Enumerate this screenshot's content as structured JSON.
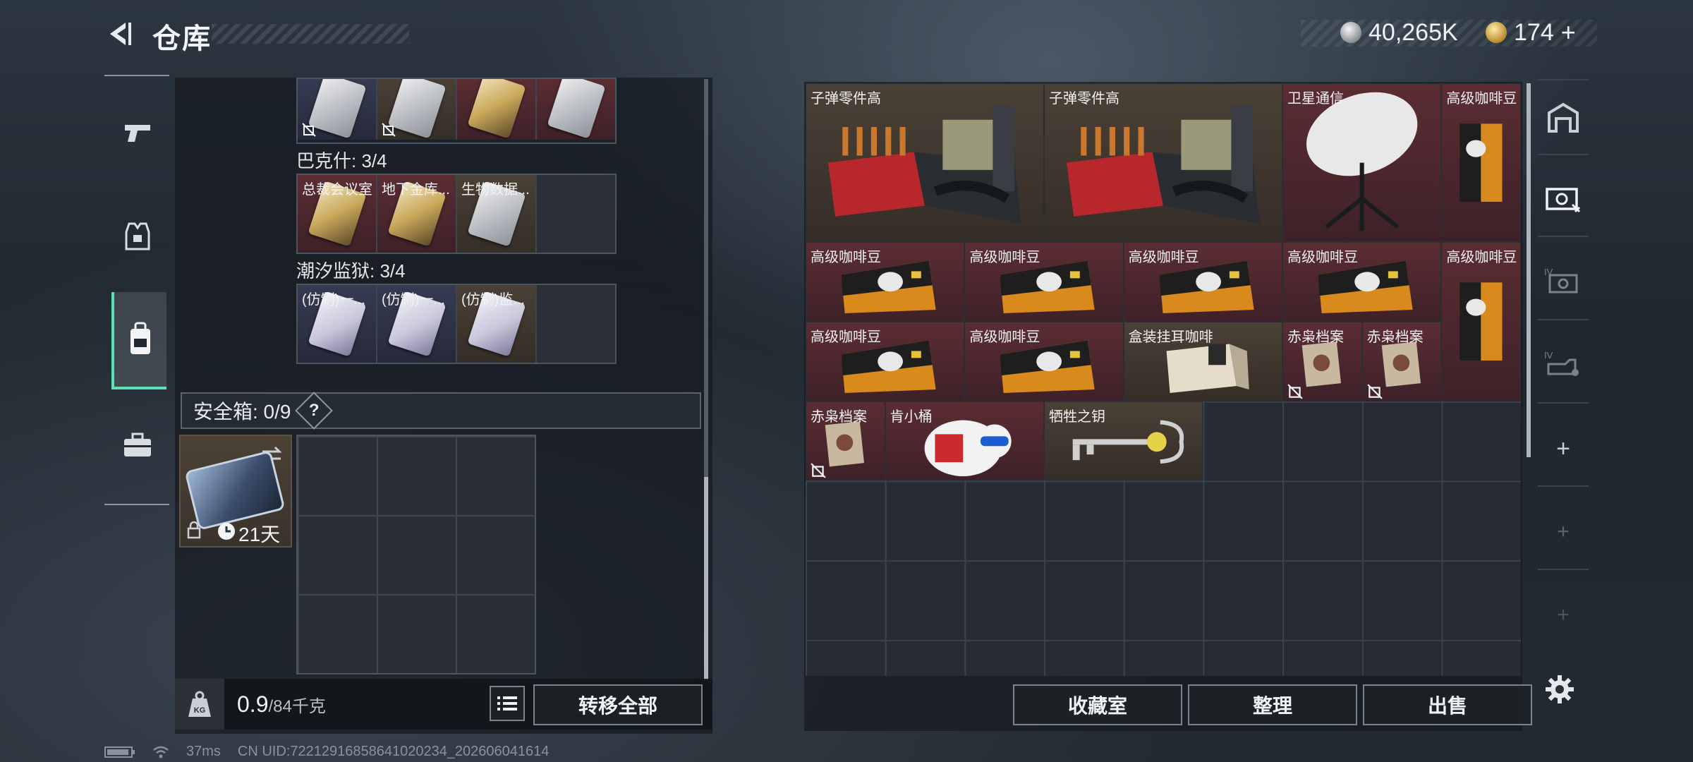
{
  "header": {
    "title": "仓库",
    "currency_silver": "40,265K",
    "currency_gold": "174"
  },
  "left_sidebar": {
    "tabs": [
      "weapons",
      "armor",
      "backpack",
      "briefcase"
    ],
    "active_index": 2
  },
  "keycards": {
    "sections": [
      {
        "name": null,
        "cells": [
          {
            "label": "",
            "tone": "blue",
            "card": "silver",
            "nodrop": true
          },
          {
            "label": "",
            "tone": "tan",
            "card": "silver",
            "nodrop": true
          },
          {
            "label": "",
            "tone": "red",
            "card": "gold",
            "nodrop": false
          },
          {
            "label": "",
            "tone": "red",
            "card": "silver",
            "nodrop": false
          }
        ]
      },
      {
        "name": "巴克什: 3/4",
        "cells": [
          {
            "label": "总裁会议室",
            "tone": "red",
            "card": "gold",
            "nodrop": false
          },
          {
            "label": "地下金库...",
            "tone": "red",
            "card": "gold",
            "nodrop": false
          },
          {
            "label": "生物数据...",
            "tone": "tan",
            "card": "silver",
            "nodrop": false
          },
          {
            "label": "",
            "tone": "empty",
            "card": null,
            "nodrop": false
          }
        ]
      },
      {
        "name": "潮汐监狱: 3/4",
        "cells": [
          {
            "label": "(仿制)一...",
            "tone": "blue",
            "card": "violet",
            "nodrop": false
          },
          {
            "label": "(仿制)一...",
            "tone": "blue",
            "card": "violet",
            "nodrop": false
          },
          {
            "label": "(仿制)监...",
            "tone": "tan",
            "card": "violet",
            "nodrop": false
          },
          {
            "label": "",
            "tone": "empty",
            "card": null,
            "nodrop": false
          }
        ]
      }
    ]
  },
  "safebox": {
    "label": "安全箱: 0/9",
    "help": "?",
    "duration": "21天"
  },
  "left_bottom": {
    "weight_current": "0.9",
    "weight_max": "/84千克",
    "transfer_all": "转移全部"
  },
  "stash_items": [
    {
      "label": "子弹零件高",
      "col": 0,
      "row": 0,
      "w": 3,
      "h": 2,
      "tone": "tan",
      "art": "ammo-crate"
    },
    {
      "label": "子弹零件高",
      "col": 3,
      "row": 0,
      "w": 3,
      "h": 2,
      "tone": "tan",
      "art": "ammo-crate"
    },
    {
      "label": "卫星通信",
      "col": 6,
      "row": 0,
      "w": 2,
      "h": 2,
      "tone": "red",
      "art": "satellite-dish"
    },
    {
      "label": "高级咖啡豆",
      "col": 8,
      "row": 0,
      "w": 1,
      "h": 2,
      "tone": "red",
      "art": "coffee-bag-tall"
    },
    {
      "label": "高级咖啡豆",
      "col": 0,
      "row": 2,
      "w": 2,
      "h": 1,
      "tone": "red",
      "art": "coffee-bag"
    },
    {
      "label": "高级咖啡豆",
      "col": 2,
      "row": 2,
      "w": 2,
      "h": 1,
      "tone": "red",
      "art": "coffee-bag"
    },
    {
      "label": "高级咖啡豆",
      "col": 4,
      "row": 2,
      "w": 2,
      "h": 1,
      "tone": "red",
      "art": "coffee-bag"
    },
    {
      "label": "高级咖啡豆",
      "col": 6,
      "row": 2,
      "w": 2,
      "h": 1,
      "tone": "red",
      "art": "coffee-bag"
    },
    {
      "label": "高级咖啡豆",
      "col": 8,
      "row": 2,
      "w": 1,
      "h": 2,
      "tone": "red",
      "art": "coffee-bag-tall"
    },
    {
      "label": "高级咖啡豆",
      "col": 0,
      "row": 3,
      "w": 2,
      "h": 1,
      "tone": "red",
      "art": "coffee-bag"
    },
    {
      "label": "高级咖啡豆",
      "col": 2,
      "row": 3,
      "w": 2,
      "h": 1,
      "tone": "red",
      "art": "coffee-bag"
    },
    {
      "label": "盒装挂耳咖啡",
      "col": 4,
      "row": 3,
      "w": 2,
      "h": 1,
      "tone": "tan",
      "art": "coffee-box"
    },
    {
      "label": "赤枭档案",
      "col": 6,
      "row": 3,
      "w": 1,
      "h": 1,
      "tone": "red",
      "art": "dossier",
      "nodrop": true
    },
    {
      "label": "赤枭档案",
      "col": 7,
      "row": 3,
      "w": 1,
      "h": 1,
      "tone": "red",
      "art": "dossier",
      "nodrop": true
    },
    {
      "label": "赤枭档案",
      "col": 0,
      "row": 4,
      "w": 1,
      "h": 1,
      "tone": "red",
      "art": "dossier",
      "nodrop": true
    },
    {
      "label": "肯小桶",
      "col": 1,
      "row": 4,
      "w": 2,
      "h": 1,
      "tone": "red",
      "art": "mascot-bucket"
    },
    {
      "label": "牺牲之钥",
      "col": 3,
      "row": 4,
      "w": 2,
      "h": 1,
      "tone": "tan",
      "art": "ornate-key"
    }
  ],
  "right_sidebar": {
    "tabs": [
      "stash-main",
      "stash-2",
      "stash-iv-a",
      "stash-iv-b",
      "add-stash",
      "add-stash-locked",
      "add-stash-locked-2"
    ]
  },
  "right_bottom": {
    "collection": "收藏室",
    "organize": "整理",
    "sell": "出售"
  },
  "status_bar": {
    "ping": "37ms",
    "uid": "CN UID:72212916858641020234_202606041614"
  },
  "colors": {
    "accent_green": "#5fe0b0",
    "cell_red": "#5b2d33",
    "cell_tan": "#4a4036",
    "cell_blue": "#363b52"
  }
}
